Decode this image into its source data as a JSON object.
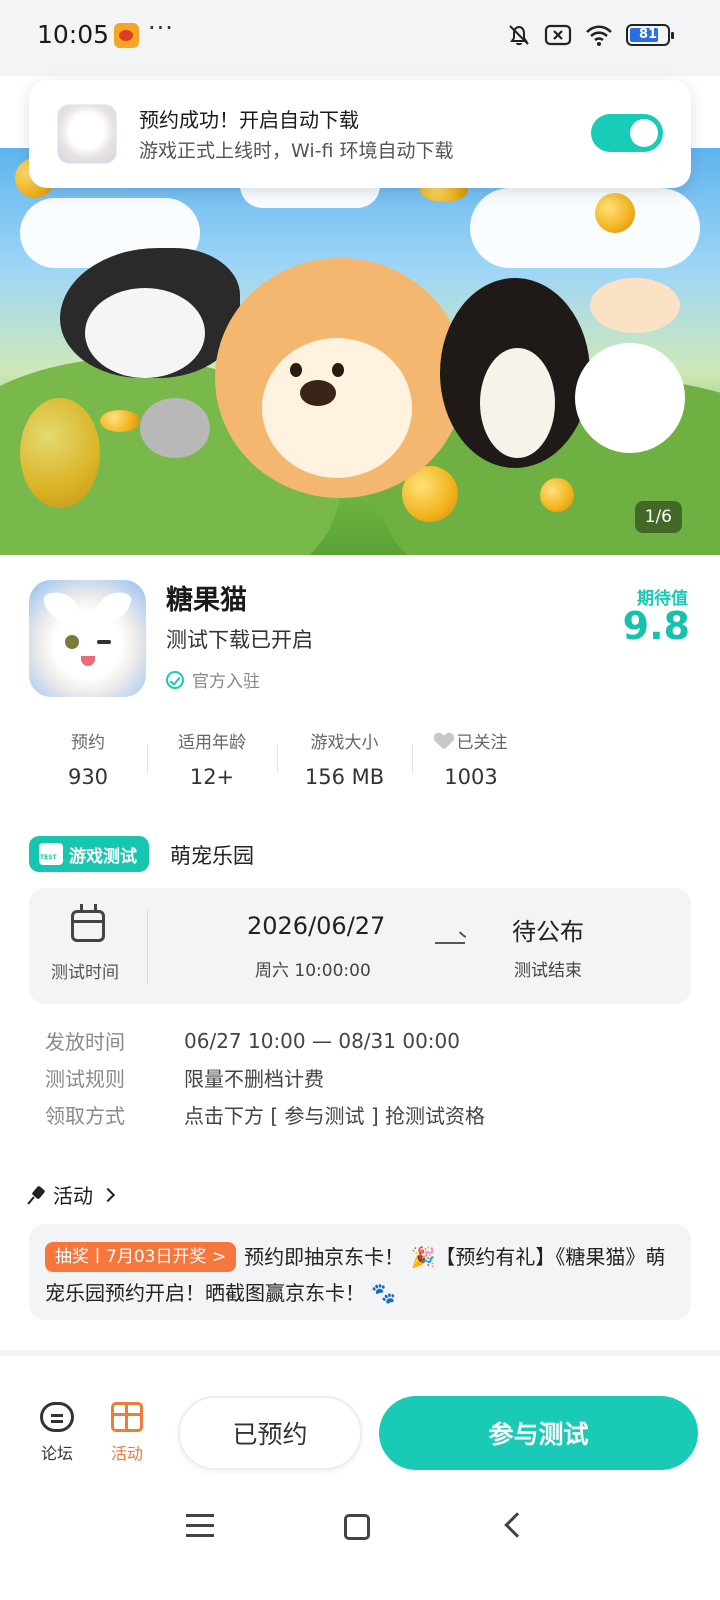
{
  "status_bar": {
    "time": "10:05",
    "more": "···",
    "battery_percent": 81,
    "battery_label": "81"
  },
  "toast": {
    "title": "预约成功！开启自动下载",
    "subtitle": "游戏正式上线时，Wi-fi 环境自动下载",
    "auto_download_enabled": true
  },
  "banner": {
    "indicator": "1/6"
  },
  "game": {
    "name": "糖果猫",
    "subtitle": "测试下载已开启",
    "official_label": "官方入驻",
    "rating_label": "期待值",
    "rating_value": "9.8"
  },
  "stats": [
    {
      "label": "预约",
      "value": "930"
    },
    {
      "label": "适用年龄",
      "value": "12+"
    },
    {
      "label": "游戏大小",
      "value": "156 MB"
    },
    {
      "label": "已关注",
      "value": "1003"
    }
  ],
  "test": {
    "badge": "游戏测试",
    "name": "萌宠乐园",
    "time_label": "测试时间",
    "start_date": "2026/06/27",
    "start_sub": "周六  10:00:00",
    "end_date": "待公布",
    "end_sub": "测试结束",
    "info": [
      {
        "key": "发放时间",
        "value": "06/27 10:00 — 08/31 00:00"
      },
      {
        "key": "测试规则",
        "value": "限量不删档计费"
      },
      {
        "key": "领取方式",
        "value": "点击下方 [ 参与测试 ] 抢测试资格"
      }
    ]
  },
  "activity": {
    "header": "活动",
    "badge": "抽奖丨7月03日开奖 >",
    "text": "预约即抽京东卡！ 🎉【预约有礼】《糖果猫》萌宠乐园预约开启！晒截图赢京东卡！ 🐾"
  },
  "bottom_bar": {
    "forum_label": "论坛",
    "activity_label": "活动",
    "reserved_label": "已预约",
    "join_label": "参与测试"
  },
  "colors": {
    "accent": "#19cbb6",
    "orange": "#f07a3a",
    "lottery": "#f7763c"
  }
}
